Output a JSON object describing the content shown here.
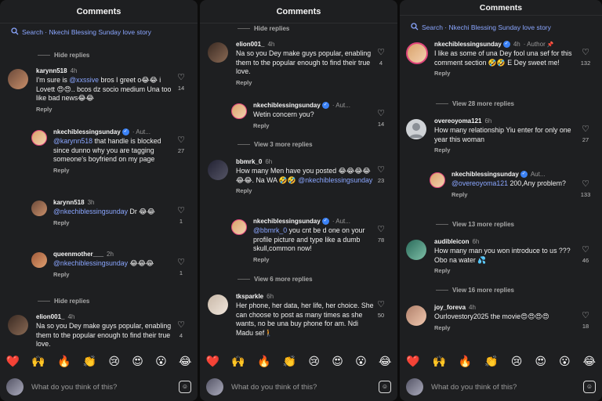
{
  "header": {
    "title": "Comments"
  },
  "search": {
    "label": "Search · Nkechi Blessing Sunday love story"
  },
  "composer": {
    "placeholder": "What do you think of this?"
  },
  "emojis": [
    "❤️",
    "🙌",
    "🔥",
    "👏",
    "😢",
    "😍",
    "😮",
    "😂"
  ],
  "p1": {
    "hide1": "Hide replies",
    "c1": {
      "user": "karynn518",
      "time": "4h",
      "pre": "I'm sure is ",
      "mention": "@xxssive",
      "post": " bros I greet o😂😂 i Lovett 😍😍.. bcos dz socio medium Una too like bad news😂😂",
      "reply": "Reply",
      "likes": "14"
    },
    "c2": {
      "user": "nkechiblessingsunday",
      "time": "· Aut...",
      "mention": "@karynn518",
      "post": " that handle is blocked since dunno why you are tagging someone's boyfriend on my page",
      "reply": "Reply",
      "likes": "27"
    },
    "c3": {
      "user": "karynn518",
      "time": "3h",
      "mention": "@nkechiblessingsunday",
      "post": " Dr 😂😂",
      "reply": "Reply",
      "likes": "1"
    },
    "c4": {
      "user": "queenmother___",
      "time": "2h",
      "mention": "@nkechiblessingsunday",
      "post": " 😂😂😂",
      "reply": "Reply",
      "likes": "1"
    },
    "hide2": "Hide replies",
    "c5": {
      "user": "elion001_",
      "time": "4h",
      "text": "Na so you Dey make guys popular, enabling them to the popular enough to find their true love.",
      "likes": "4"
    }
  },
  "p2": {
    "hide1": "Hide replies",
    "c1": {
      "user": "elion001_",
      "time": "4h",
      "text": "Na so you Dey make guys popular, enabling them to the popular enough to find their true love.",
      "reply": "Reply",
      "likes": "4"
    },
    "c2": {
      "user": "nkechiblessingsunday",
      "time": "· Aut...",
      "text": "Wetin concern you?",
      "reply": "Reply",
      "likes": "14"
    },
    "view1": "View 3 more replies",
    "c3": {
      "user": "bbmrk_0",
      "time": "6h",
      "text": "How many Men have you posted 😂😂😂😂😂😂. Na WA 🤣🤣",
      "mention": "@nkechiblessingsunday",
      "reply": "Reply",
      "likes": "23"
    },
    "c4": {
      "user": "nkechiblessingsunday",
      "time": "· Aut...",
      "mention": "@bbmrk_0",
      "post": " you cnt be d one on your profile picture and type like a dumb skull,common now!",
      "reply": "Reply",
      "likes": "78"
    },
    "view2": "View 6 more replies",
    "c5": {
      "user": "tksparkle",
      "time": "6h",
      "text": "Her phone, her data, her life, her choice. She can choose to post as many times as she wants, no be una buy phone for am. Ndi Madu sef🚶",
      "likes": "50"
    }
  },
  "p3": {
    "c1": {
      "user": "nkechiblessingsunday",
      "time": "4h",
      "author": "· Author",
      "text": "I like as some of una Dey fool una sef for this comment section 🤣🤣 E Dey sweet me!",
      "reply": "Reply",
      "likes": "132"
    },
    "view1": "View 28 more replies",
    "c2": {
      "user": "overeoyoma121",
      "time": "6h",
      "text": "How many relationship Yiu enter for only one year this woman",
      "reply": "Reply",
      "likes": "27"
    },
    "c3": {
      "user": "nkechiblessingsunday",
      "time": "Aut...",
      "mention": "@overeoyoma121",
      "post": " 200,Any problem?",
      "reply": "Reply",
      "likes": "133"
    },
    "view2": "View 13 more replies",
    "c4": {
      "user": "audibleicon",
      "time": "6h",
      "text": "How many man you won introduce to us ??? Obo na water 💦",
      "reply": "Reply",
      "likes": "46"
    },
    "view3": "View 16 more replies",
    "c5": {
      "user": "joy_foreva",
      "time": "4h",
      "text": "Ourlovestory2025 the movie😍😍😍😍",
      "reply": "Reply",
      "likes": "18"
    }
  },
  "colors": {
    "bg": "#1e1f21",
    "mention": "#8aa6ff",
    "verified": "#3b82f6"
  }
}
